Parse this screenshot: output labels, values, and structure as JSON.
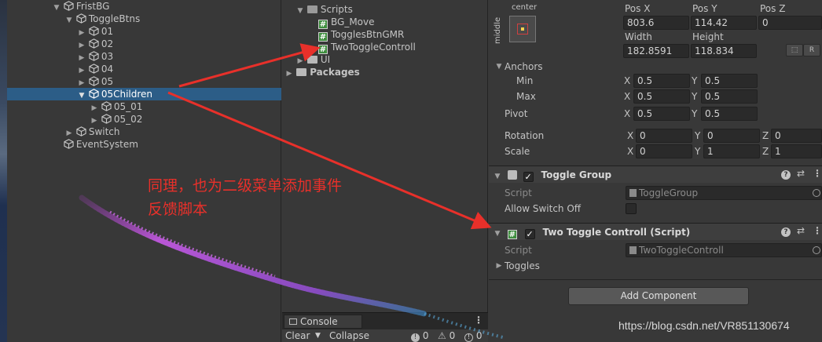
{
  "hierarchy": {
    "items": [
      {
        "label": "FristBG"
      },
      {
        "label": "ToggleBtns"
      },
      {
        "label": "01"
      },
      {
        "label": "02"
      },
      {
        "label": "03"
      },
      {
        "label": "04"
      },
      {
        "label": "05"
      },
      {
        "label": "05Children"
      },
      {
        "label": "05_01"
      },
      {
        "label": "05_02"
      },
      {
        "label": "Switch"
      },
      {
        "label": "EventSystem"
      }
    ]
  },
  "project": {
    "scripts_folder": "Scripts",
    "files": [
      "BG_Move",
      "TogglesBtnGMR",
      "TwoToggleControll"
    ],
    "ui_folder": "UI",
    "packages_folder": "Packages",
    "file_icon": "#"
  },
  "console": {
    "tab_label": "Console",
    "clear_label": "Clear",
    "collapse_label": "Collapse",
    "info_count": "0",
    "warning_count": "0",
    "error_count": "0"
  },
  "inspector": {
    "rect": {
      "anchor_preset_h": "center",
      "anchor_preset_v": "middle",
      "pos_x_label": "Pos X",
      "pos_y_label": "Pos Y",
      "pos_z_label": "Pos Z",
      "pos_x": "803.6",
      "pos_y": "114.42",
      "pos_z": "0",
      "width_label": "Width",
      "height_label": "Height",
      "width": "182.8591",
      "height": "118.834",
      "r_label": "R"
    },
    "anchors": {
      "title": "Anchors",
      "min_label": "Min",
      "max_label": "Max",
      "x_label": "X",
      "y_label": "Y",
      "min_x": "0.5",
      "min_y": "0.5",
      "max_x": "0.5",
      "max_y": "0.5"
    },
    "pivot": {
      "label": "Pivot",
      "x": "0.5",
      "y": "0.5"
    },
    "rotation": {
      "label": "Rotation",
      "x": "0",
      "y": "0",
      "z": "0"
    },
    "scale": {
      "label": "Scale",
      "x": "0",
      "y": "1",
      "z": "1"
    },
    "toggle_group": {
      "title": "Toggle Group",
      "script_label": "Script",
      "script_value": "ToggleGroup",
      "allow_switch_off_label": "Allow Switch Off"
    },
    "two_toggle": {
      "title": "Two Toggle Controll (Script)",
      "script_label": "Script",
      "script_value": "TwoToggleControll",
      "toggles_label": "Toggles"
    },
    "add_component_label": "Add Component"
  },
  "annotation": {
    "line1": "同理，也为二级菜单添加事件",
    "line2": "反馈脚本",
    "color": "#e8302a"
  },
  "watermark": "https://blog.csdn.net/VR851130674"
}
